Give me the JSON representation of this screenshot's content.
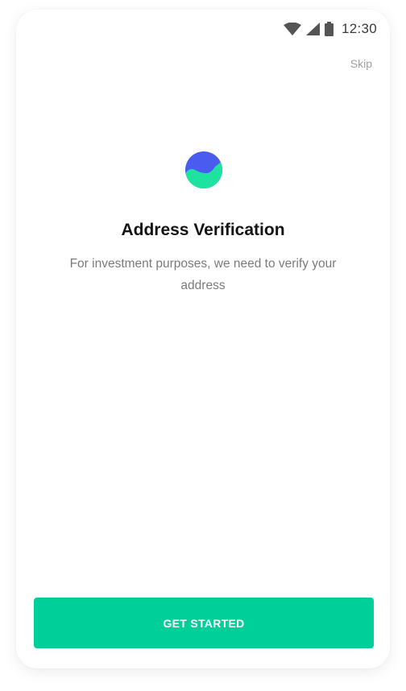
{
  "status_bar": {
    "time": "12:30",
    "icons": [
      "wifi-icon",
      "cellular-signal-icon",
      "battery-icon"
    ]
  },
  "header": {
    "skip_label": "Skip"
  },
  "main": {
    "logo_icon": "chart-wave-logo-icon",
    "title": "Address Verification",
    "subtitle": "For investment purposes, we need to verify your address"
  },
  "footer": {
    "cta_label": "GET STARTED"
  },
  "colors": {
    "accent": "#00cf99",
    "logo_blue": "#4a5bf0",
    "logo_green": "#1ee3a0",
    "title": "#141414",
    "muted": "#7a7a7a"
  }
}
